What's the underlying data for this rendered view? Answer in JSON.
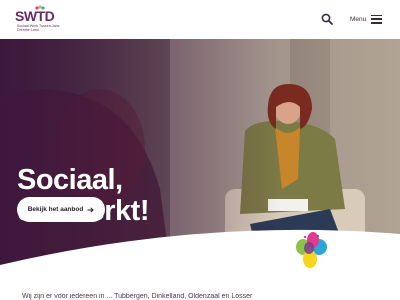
{
  "header": {
    "logo_text": "SWTD",
    "logo_subtitle": "Sociaal Werk Tussen-Jans Drenthe Land",
    "menu_label": "Menu"
  },
  "hero": {
    "title_line1": "Sociaal,",
    "title_line2": "dat werkt!",
    "cta_label": "Bekijk het aanbod"
  },
  "teaser": {
    "text": "Wij zijn er voor iedereen in ... Tubbergen, Dinkelland, Oldenzaal en Losser"
  },
  "colors": {
    "brand_purple": "#5c2463",
    "hero_overlay": "#3d1540",
    "text_dark": "#2a1a2a"
  },
  "icons": [
    "search-icon",
    "hamburger-icon",
    "arrow-right-icon",
    "petal-logo"
  ]
}
